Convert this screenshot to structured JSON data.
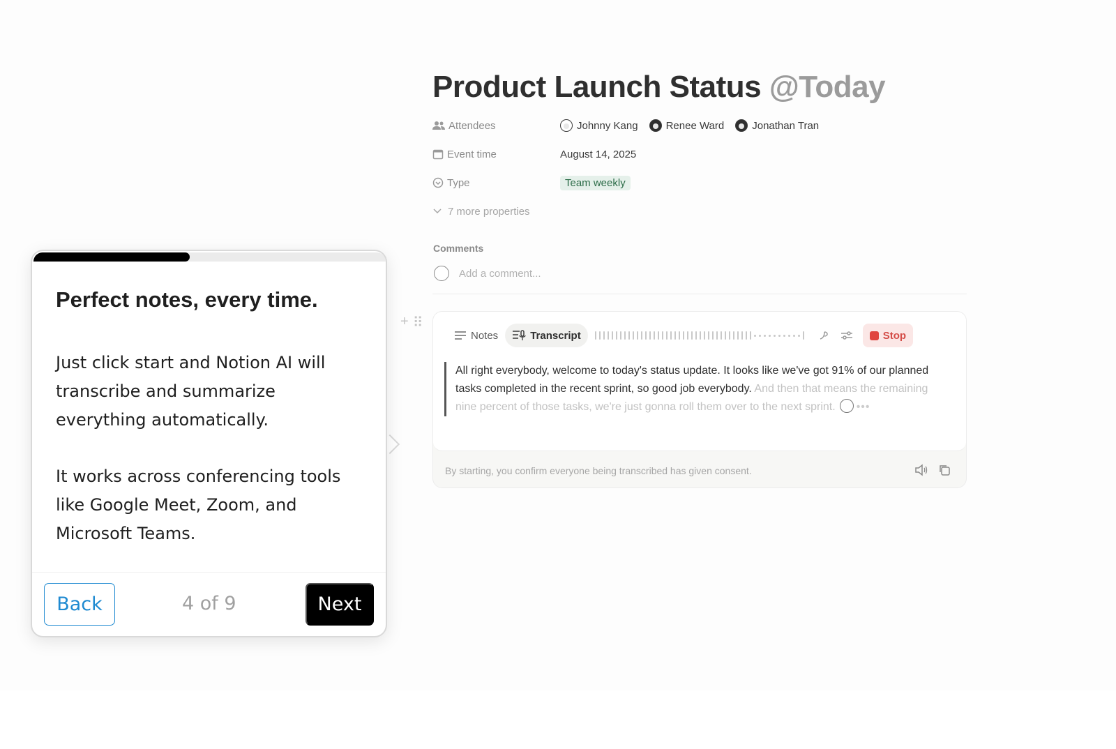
{
  "page": {
    "title": "Product Launch Status",
    "title_mention": "@Today",
    "properties": [
      {
        "icon": "people-icon",
        "name": "Attendees"
      },
      {
        "icon": "calendar-icon",
        "name": "Event time",
        "value": "August 14, 2025"
      },
      {
        "icon": "select-icon",
        "name": "Type",
        "value": "Team weekly"
      }
    ],
    "attendees": [
      "Johnny Kang",
      "Renee Ward",
      "Jonathan Tran"
    ],
    "more_properties": "7 more properties",
    "comments_label": "Comments",
    "comment_placeholder": "Add a comment..."
  },
  "ai_block": {
    "tabs": {
      "notes": "Notes",
      "transcript": "Transcript"
    },
    "stop_label": "Stop",
    "transcript_solid": "All right everybody, welcome to today's status update. It looks like we've got 91% of our planned tasks completed in the recent sprint, so good job everybody.",
    "transcript_faded": "And then that means the remaining nine percent of those tasks, we're just gonna roll them over to the next sprint.",
    "consent": "By starting, you confirm everyone being transcribed has given consent.",
    "colors": {
      "stop_bg": "#fbe7e6",
      "stop_text": "#d44c47"
    }
  },
  "onboarding": {
    "progress": 0.444,
    "title": "Perfect notes, every time.",
    "paragraph_1": "Just click start and Notion AI will transcribe and summarize everything automatically.",
    "paragraph_2": "It works across conferencing tools like Google Meet, Zoom, and Microsoft Teams.",
    "back_label": "Back",
    "step_text": "4 of 9",
    "next_label": "Next",
    "colors": {
      "back_accent": "#1f8ad1",
      "next_bg": "#000000"
    }
  }
}
